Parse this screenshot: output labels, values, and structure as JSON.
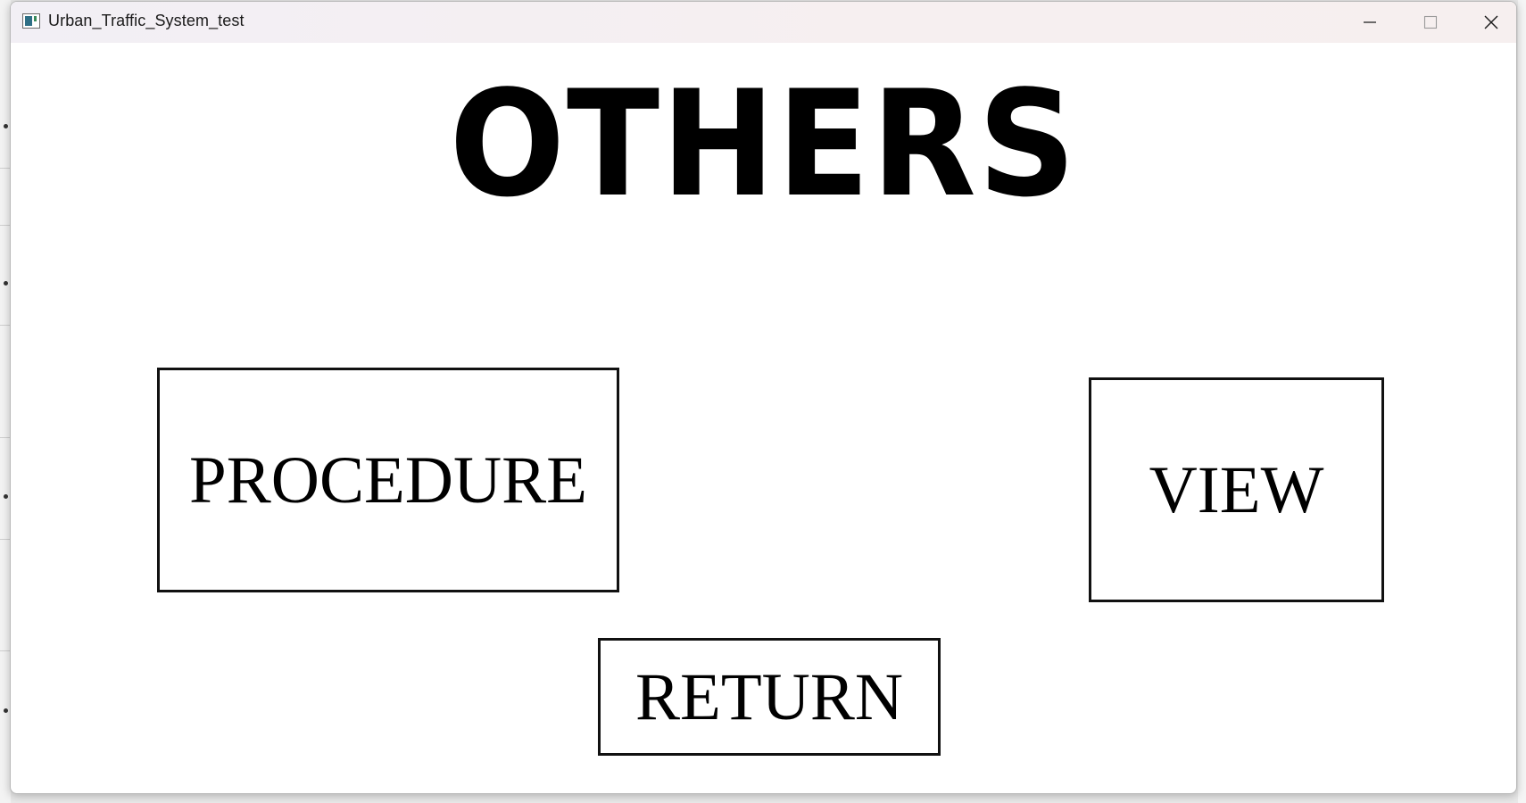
{
  "window": {
    "title": "Urban_Traffic_System_test",
    "controls": {
      "minimize": "minimize-icon",
      "maximize": "maximize-icon",
      "close": "close-icon"
    }
  },
  "page": {
    "heading": "OTHERS",
    "buttons": {
      "procedure": "PROCEDURE",
      "view": "VIEW",
      "return": "RETURN"
    }
  },
  "colors": {
    "text": "#000000",
    "background": "#ffffff",
    "titlebar": "#f4eff2"
  }
}
